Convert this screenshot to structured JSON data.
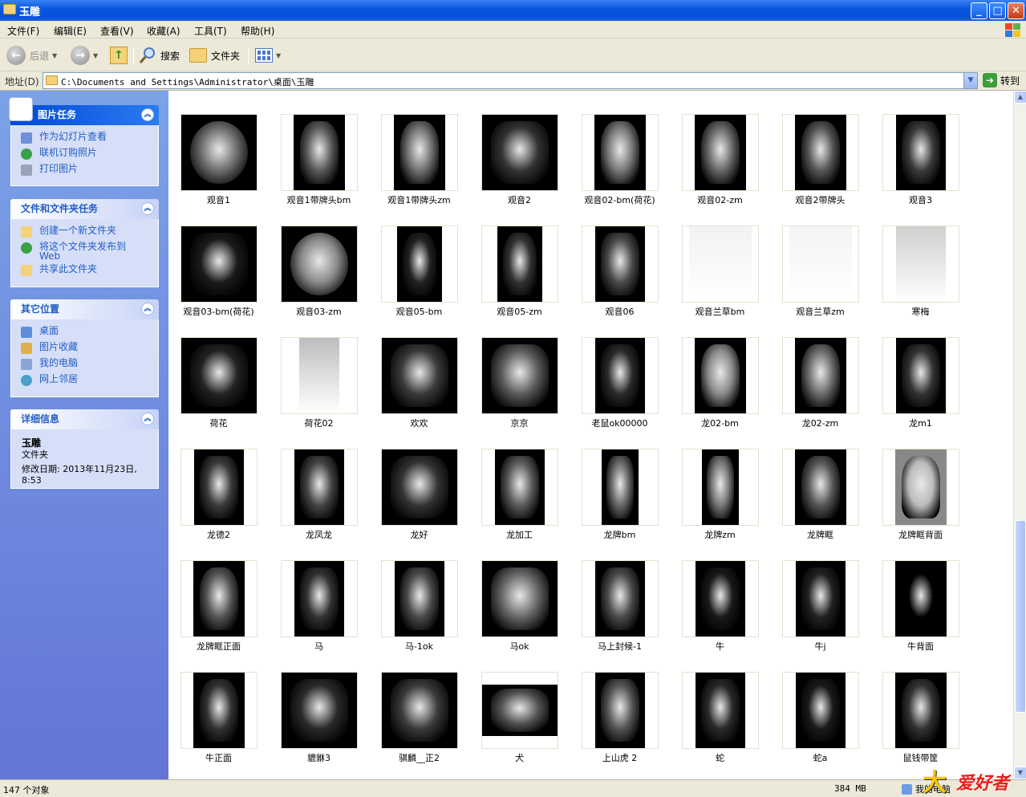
{
  "window": {
    "title": "玉雕",
    "min": "_",
    "max": "□",
    "close": "✕"
  },
  "menu": [
    "文件(F)",
    "编辑(E)",
    "查看(V)",
    "收藏(A)",
    "工具(T)",
    "帮助(H)"
  ],
  "toolbar": {
    "back": "后退",
    "search": "搜索",
    "folders": "文件夹"
  },
  "address": {
    "label": "地址(D)",
    "path": "C:\\Documents and Settings\\Administrator\\桌面\\玉雕",
    "go": "转到"
  },
  "tasks": {
    "picture": {
      "title": "图片任务",
      "items": [
        "作为幻灯片查看",
        "联机订购照片",
        "打印图片"
      ]
    },
    "file": {
      "title": "文件和文件夹任务",
      "items": [
        "创建一个新文件夹",
        "将这个文件夹发布到 Web",
        "共享此文件夹"
      ]
    },
    "places": {
      "title": "其它位置",
      "items": [
        "桌面",
        "图片收藏",
        "我的电脑",
        "网上邻居"
      ]
    },
    "details": {
      "title": "详细信息",
      "name": "玉雕",
      "type": "文件夹",
      "date": "修改日期: 2013年11月23日, 8:53"
    }
  },
  "thumbnails": [
    {
      "caption": "观音1",
      "shape": "oval-wide",
      "tone": "#6a6a6a"
    },
    {
      "caption": "观音1带牌头bm",
      "shape": "plaque",
      "tone": "#5a5a5a"
    },
    {
      "caption": "观音1带牌头zm",
      "shape": "plaque",
      "tone": "#707070"
    },
    {
      "caption": "观音2",
      "shape": "square",
      "tone": "#333"
    },
    {
      "caption": "观音02-bm(荷花)",
      "shape": "plaque",
      "tone": "#777"
    },
    {
      "caption": "观音02-zm",
      "shape": "plaque",
      "tone": "#666"
    },
    {
      "caption": "观音2带牌头",
      "shape": "plaque",
      "tone": "#555"
    },
    {
      "caption": "观音3",
      "shape": "tall",
      "tone": "#3a3a3a"
    },
    {
      "caption": "观音03-bm(荷花)",
      "shape": "square",
      "tone": "#1a1a1a"
    },
    {
      "caption": "观音03-zm",
      "shape": "oval-wide",
      "tone": "#888"
    },
    {
      "caption": "观音05-bm",
      "shape": "plaque-dark",
      "tone": "#222"
    },
    {
      "caption": "观音05-zm",
      "shape": "plaque-dark",
      "tone": "#333"
    },
    {
      "caption": "观音06",
      "shape": "tall",
      "tone": "#4a4a4a"
    },
    {
      "caption": "观音兰草bm",
      "shape": "light",
      "tone": "#f2f2f2"
    },
    {
      "caption": "观音兰草zm",
      "shape": "light",
      "tone": "#f4f4f4"
    },
    {
      "caption": "寒梅",
      "shape": "light-tall",
      "tone": "#cfcfcf"
    },
    {
      "caption": "荷花",
      "shape": "square",
      "tone": "#222"
    },
    {
      "caption": "荷花02",
      "shape": "light-strip",
      "tone": "#bdbdbd"
    },
    {
      "caption": "欢欢",
      "shape": "square",
      "tone": "#3a3a3a"
    },
    {
      "caption": "京京",
      "shape": "square",
      "tone": "#5a5a5a"
    },
    {
      "caption": "老鼠ok00000",
      "shape": "tall",
      "tone": "#2a2a2a"
    },
    {
      "caption": "龙02-bm",
      "shape": "plaque",
      "tone": "#8a8a8a"
    },
    {
      "caption": "龙02-zm",
      "shape": "plaque",
      "tone": "#6a6a6a"
    },
    {
      "caption": "龙m1",
      "shape": "tall",
      "tone": "#333"
    },
    {
      "caption": "龙德2",
      "shape": "tall",
      "tone": "#3a3a3a"
    },
    {
      "caption": "龙凤龙",
      "shape": "tall",
      "tone": "#444"
    },
    {
      "caption": "龙好",
      "shape": "square",
      "tone": "#333"
    },
    {
      "caption": "龙加工",
      "shape": "tall",
      "tone": "#5a5a5a"
    },
    {
      "caption": "龙牌bm",
      "shape": "narrow",
      "tone": "#666"
    },
    {
      "caption": "龙牌zm",
      "shape": "narrow",
      "tone": "#777"
    },
    {
      "caption": "龙牌眶",
      "shape": "plaque",
      "tone": "#555"
    },
    {
      "caption": "龙牌眶背面",
      "shape": "plaque-light",
      "tone": "#bbb"
    },
    {
      "caption": "龙牌眶正面",
      "shape": "plaque",
      "tone": "#555"
    },
    {
      "caption": "马",
      "shape": "tall",
      "tone": "#333"
    },
    {
      "caption": "马-1ok",
      "shape": "tall",
      "tone": "#4a4a4a"
    },
    {
      "caption": "马ok",
      "shape": "square",
      "tone": "#666"
    },
    {
      "caption": "马上封候-1",
      "shape": "tall",
      "tone": "#4a4a4a"
    },
    {
      "caption": "牛",
      "shape": "tall",
      "tone": "#1a1a1a"
    },
    {
      "caption": "牛j",
      "shape": "tall",
      "tone": "#222"
    },
    {
      "caption": "牛背面",
      "shape": "plaque-text",
      "tone": "#000"
    },
    {
      "caption": "牛正面",
      "shape": "plaque",
      "tone": "#333"
    },
    {
      "caption": "貔貅3",
      "shape": "square",
      "tone": "#2a2a2a"
    },
    {
      "caption": "骐麟__正2",
      "shape": "square",
      "tone": "#3a3a3a"
    },
    {
      "caption": "犬",
      "shape": "wide",
      "tone": "#555"
    },
    {
      "caption": "上山虎 2",
      "shape": "tall",
      "tone": "#555"
    },
    {
      "caption": "蛇",
      "shape": "tall",
      "tone": "#2a2a2a"
    },
    {
      "caption": "蛇a",
      "shape": "tall",
      "tone": "#1a1a1a"
    },
    {
      "caption": "鼠钱带筐",
      "shape": "plaque",
      "tone": "#333"
    }
  ],
  "status": {
    "count": "147 个对象",
    "size": "384 MB",
    "zone": "我的电脑"
  },
  "watermark": {
    "char": "大",
    "text": "爱好者"
  }
}
